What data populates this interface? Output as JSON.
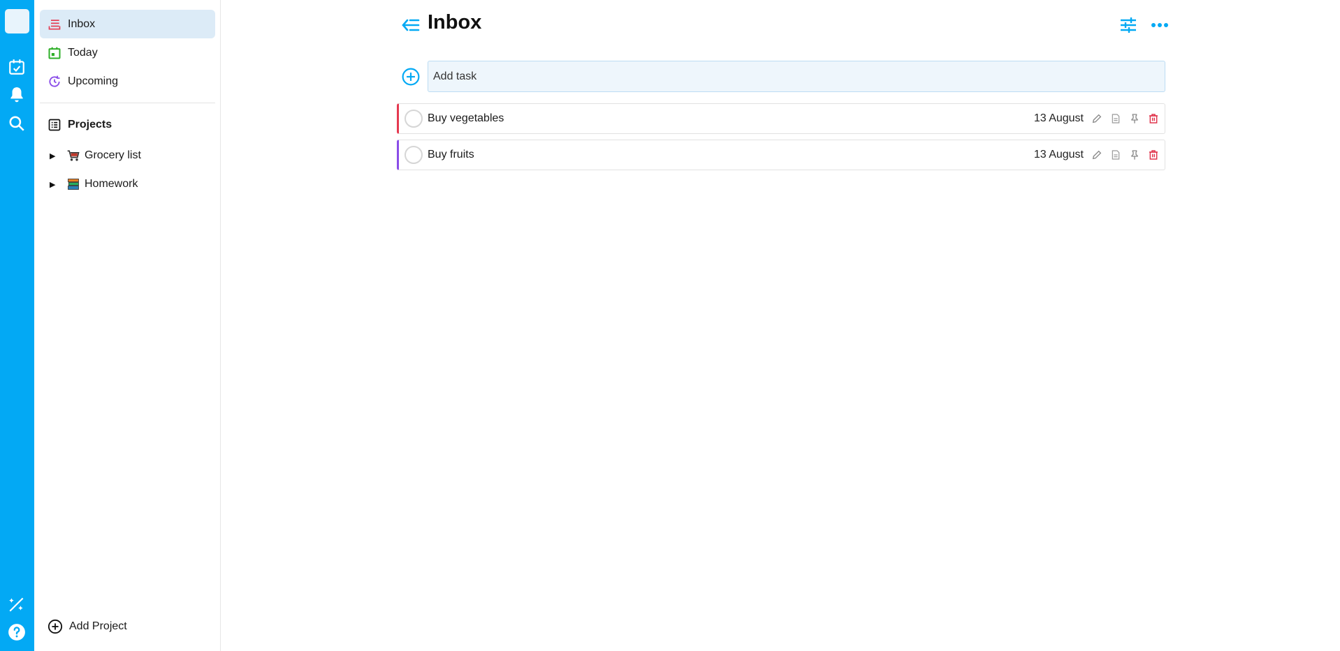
{
  "colors": {
    "accent": "#03a9f4",
    "inbox_red": "#e53950",
    "today_green": "#2eaf28",
    "upcoming_purple": "#8a4de8",
    "delete_red": "#e0324a",
    "task1_border": "#e53950",
    "task2_border": "#8a4de8"
  },
  "rail": {
    "icons": [
      "calendar-check-icon",
      "bell-icon",
      "search-icon",
      "wand-icon",
      "help-icon"
    ]
  },
  "sidebar": {
    "items": [
      {
        "label": "Inbox",
        "icon": "inbox-icon"
      },
      {
        "label": "Today",
        "icon": "today-calendar-icon"
      },
      {
        "label": "Upcoming",
        "icon": "upcoming-clock-icon"
      }
    ],
    "projects_label": "Projects",
    "projects": [
      {
        "label": "Grocery list",
        "icon": "shopping-cart-icon"
      },
      {
        "label": "Homework",
        "icon": "books-icon"
      }
    ],
    "add_project_label": "Add Project"
  },
  "header": {
    "title": "Inbox"
  },
  "add_task": {
    "placeholder": "Add task"
  },
  "tasks": [
    {
      "name": "Buy vegetables",
      "date": "13 August"
    },
    {
      "name": "Buy fruits",
      "date": "13 August"
    }
  ]
}
